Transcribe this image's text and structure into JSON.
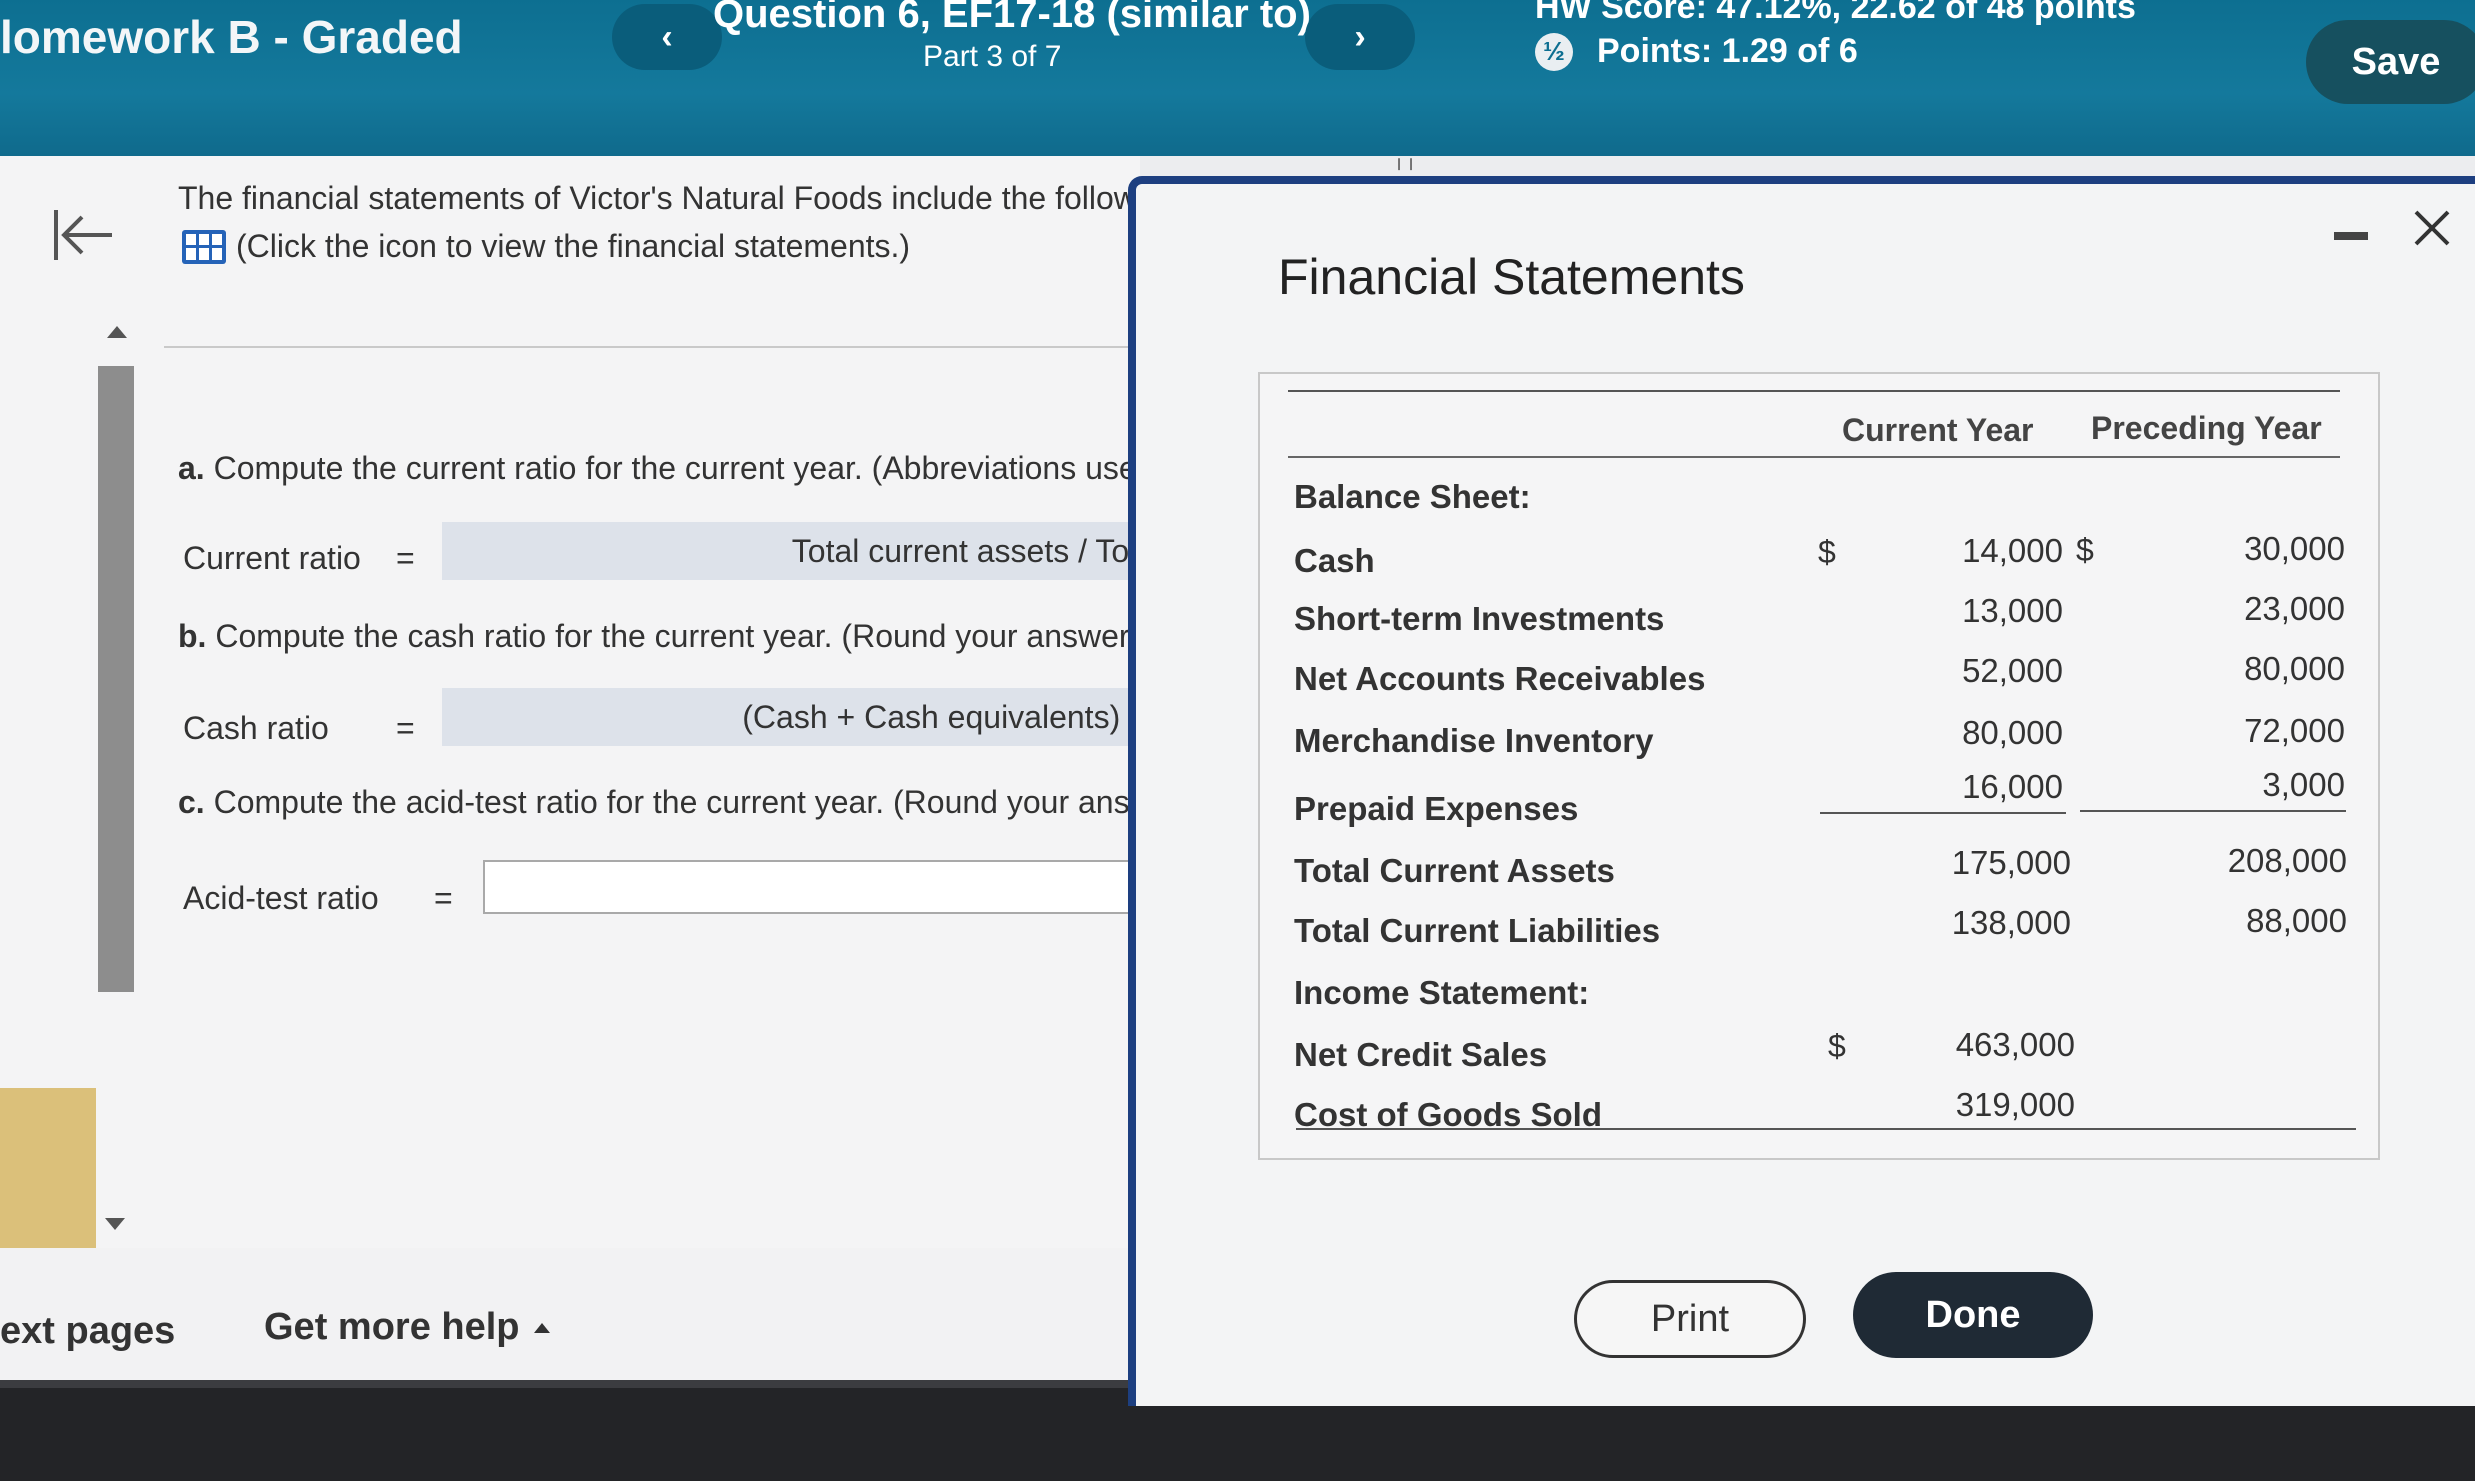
{
  "header": {
    "assignment_title": "lomework B - Graded",
    "question_title": "Question 6, EF17-18 (similar to)",
    "part": "Part 3 of 7",
    "hw_score": "HW Score: 47.12%, 22.62 of 48 points",
    "points": "Points: 1.29 of 6",
    "points_icon": "partial-credit-icon",
    "prev_symbol": "‹",
    "next_symbol": "›",
    "save_label": "Save"
  },
  "question": {
    "intro": "The financial statements of Victor's Natural Foods include the follow",
    "view_statements": "(Click the icon to view the financial statements.)",
    "a_prefix": "a.",
    "a_text": " Compute the current ratio for the current year. (Abbreviations use",
    "current_ratio_label": "Current ratio",
    "current_ratio_formula": "Total current assets / Tot",
    "b_prefix": "b.",
    "b_text": " Compute the cash ratio for the current year. (Round your answer",
    "cash_ratio_label": "Cash ratio",
    "cash_ratio_formula": "(Cash + Cash equivalents) /",
    "c_prefix": "c.",
    "c_text": " Compute the acid-test ratio for the current year. (Round your ans",
    "acid_test_label": "Acid-test ratio",
    "equals": "="
  },
  "footer": {
    "next_pages": "ext pages",
    "more_help": "Get more help"
  },
  "modal": {
    "title": "Financial Statements",
    "col_current": "Current Year",
    "col_preceding": "Preceding Year",
    "currency": "$",
    "balance_sheet": "Balance Sheet:",
    "income_statement": "Income Statement:",
    "rows": {
      "cash": {
        "label": "Cash",
        "current": "14,000",
        "preceding": "30,000"
      },
      "sti": {
        "label": "Short-term Investments",
        "current": "13,000",
        "preceding": "23,000"
      },
      "nar": {
        "label": "Net Accounts Receivables",
        "current": "52,000",
        "preceding": "80,000"
      },
      "inv": {
        "label": "Merchandise Inventory",
        "current": "80,000",
        "preceding": "72,000"
      },
      "pre": {
        "label": "Prepaid Expenses",
        "current": "16,000",
        "preceding": "3,000"
      },
      "tca": {
        "label": "Total Current Assets",
        "current": "175,000",
        "preceding": "208,000"
      },
      "tcl": {
        "label": "Total Current Liabilities",
        "current": "138,000",
        "preceding": "88,000"
      },
      "ncs": {
        "label": "Net Credit Sales",
        "current": "463,000"
      },
      "cogs": {
        "label": "Cost of Goods Sold",
        "current": "319,000"
      }
    },
    "print_label": "Print",
    "done_label": "Done"
  }
}
